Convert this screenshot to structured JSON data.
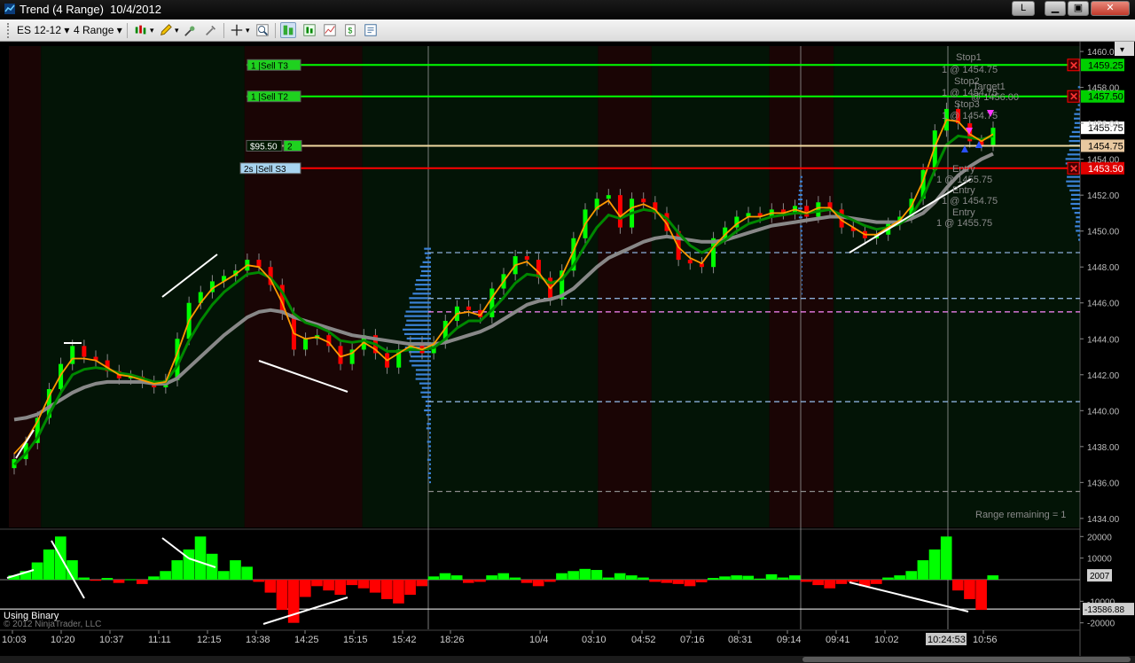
{
  "window": {
    "title": "Trend (4 Range)  10/4/2012",
    "buttons": {
      "link": "L",
      "minimize": "▁",
      "maximize": "▣",
      "close": "✕"
    }
  },
  "toolbar": {
    "instrument": "ES 12-12",
    "period": "4 Range",
    "icons": [
      "bar-style-icon",
      "pencil-icon",
      "cross-star-icon",
      "dropper-icon",
      "crosshair-icon",
      "zoom-icon",
      "chart-trader-icon",
      "data-box-icon",
      "chart-icon",
      "refresh-icon",
      "properties-icon"
    ]
  },
  "colors": {
    "bull": "#00ff00",
    "bear": "#ff0000",
    "ema_fast": "#ff9900",
    "ema_mid": "#008800",
    "ema_slow": "#888888",
    "target_line": "#00ff00",
    "stop_line": "#ff0000",
    "entry_line": "#f0d8a0",
    "pivot_dash": "#8aaed8",
    "pink_dash": "#ff88ff",
    "volume_profile": "#3b82d6"
  },
  "orders": {
    "target3": {
      "qty": "1",
      "label": "Sell T3",
      "price_tag": "1459.25",
      "price": 1459.25
    },
    "target2": {
      "qty": "1",
      "label": "Sell T2",
      "price_tag": "1457.50",
      "price": 1457.5
    },
    "position": {
      "pnl": "$95.50",
      "qty": "2",
      "price_tag": "1454.75",
      "price": 1454.75
    },
    "stop": {
      "qty": "2s",
      "label": "Sell S3",
      "price_tag": "1453.50",
      "price": 1453.5
    },
    "last_price": "1455.75",
    "last": 1455.75
  },
  "annotations": [
    "Stop1",
    "1 @ 1454.75",
    "Stop2",
    "1 @ 1454.75",
    "Target1",
    "@ 1456.00",
    "Stop3",
    "1 @ 1454.75",
    "Entry",
    "1 @ 1455.75",
    "Entry",
    "1 @ 1454.75",
    "Entry",
    "1 @ 1455.75"
  ],
  "range_remaining": "Range remaining = 1",
  "price_axis": {
    "labels": [
      "1460.0",
      "1458.00",
      "1456.00",
      "1454.00",
      "1452.00",
      "1450.00",
      "1448.00",
      "1446.00",
      "1444.00",
      "1442.00",
      "1440.00",
      "1438.00",
      "1436.00",
      "1434.00"
    ],
    "values": [
      1460,
      1458,
      1456,
      1454,
      1452,
      1450,
      1448,
      1446,
      1444,
      1442,
      1440,
      1438,
      1436,
      1434
    ]
  },
  "indicator": {
    "axis_labels": [
      "20000",
      "10000",
      "-10000",
      "-20000"
    ],
    "axis_values": [
      20000,
      10000,
      -10000,
      -20000
    ],
    "current_tag": "2007",
    "current_value": 2007,
    "low_tag": "-13586.88",
    "low_value": -13586.88,
    "title": "Using Binary",
    "copyright": "© 2012 NinjaTrader, LLC"
  },
  "time_axis": {
    "labels": [
      "10:03",
      "10:20",
      "10:37",
      "11:11",
      "12:15",
      "13:38",
      "14:25",
      "15:15",
      "15:42",
      "18:26",
      "10/4",
      "03:10",
      "04:52",
      "07:16",
      "08:31",
      "09:14",
      "09:41",
      "10:02",
      "10:56"
    ],
    "crosshair_time": "10:24:53"
  },
  "sessions": [
    {
      "from": 0,
      "to": 0.03,
      "type": "bear"
    },
    {
      "from": 0.03,
      "to": 0.22,
      "type": "bull"
    },
    {
      "from": 0.22,
      "to": 0.33,
      "type": "bear"
    },
    {
      "from": 0.33,
      "to": 0.55,
      "type": "bull"
    },
    {
      "from": 0.55,
      "to": 0.6,
      "type": "bear"
    },
    {
      "from": 0.6,
      "to": 0.71,
      "type": "bull"
    },
    {
      "from": 0.71,
      "to": 0.77,
      "type": "bear"
    },
    {
      "from": 0.77,
      "to": 1.0,
      "type": "bull"
    }
  ],
  "chart_data": {
    "type": "line",
    "ylim": [
      1433.5,
      1460.3
    ],
    "close": [
      1437.3,
      1438.2,
      1439.6,
      1441.2,
      1442.6,
      1443.6,
      1443.0,
      1442.8,
      1442.2,
      1441.8,
      1441.9,
      1441.6,
      1441.3,
      1441.7,
      1444.0,
      1446.0,
      1446.6,
      1447.2,
      1447.5,
      1447.8,
      1448.4,
      1448.0,
      1447.0,
      1445.4,
      1443.4,
      1444.0,
      1444.2,
      1443.6,
      1442.6,
      1443.4,
      1444.2,
      1443.2,
      1442.4,
      1443.4,
      1443.8,
      1443.2,
      1443.8,
      1445.0,
      1445.8,
      1445.6,
      1445.2,
      1446.8,
      1447.6,
      1448.6,
      1448.4,
      1447.4,
      1446.2,
      1447.8,
      1449.6,
      1451.2,
      1451.8,
      1452.0,
      1450.2,
      1451.8,
      1451.6,
      1451.0,
      1450.0,
      1448.4,
      1448.2,
      1448.0,
      1449.6,
      1450.2,
      1450.8,
      1451.0,
      1450.8,
      1451.2,
      1451.0,
      1451.4,
      1450.8,
      1451.6,
      1451.2,
      1450.2,
      1450.0,
      1449.6,
      1449.8,
      1450.4,
      1450.8,
      1451.8,
      1453.4,
      1455.6,
      1456.8,
      1456.0,
      1455.0,
      1454.8,
      1455.75
    ],
    "ema_fast": [
      1437.6,
      1438.3,
      1439.4,
      1440.8,
      1442.0,
      1442.9,
      1442.9,
      1442.8,
      1442.4,
      1442.0,
      1441.9,
      1441.7,
      1441.5,
      1441.6,
      1443.2,
      1445.0,
      1446.0,
      1446.8,
      1447.2,
      1447.6,
      1448.1,
      1448.0,
      1447.3,
      1446.0,
      1444.3,
      1444.0,
      1444.1,
      1443.8,
      1443.0,
      1443.2,
      1443.8,
      1443.4,
      1442.8,
      1443.2,
      1443.6,
      1443.4,
      1443.7,
      1444.6,
      1445.4,
      1445.5,
      1445.3,
      1446.3,
      1447.2,
      1448.1,
      1448.3,
      1447.7,
      1446.8,
      1447.5,
      1448.9,
      1450.4,
      1451.3,
      1451.7,
      1450.8,
      1451.3,
      1451.5,
      1451.2,
      1450.4,
      1449.1,
      1448.5,
      1448.2,
      1449.1,
      1449.8,
      1450.4,
      1450.8,
      1450.8,
      1451.0,
      1451.0,
      1451.2,
      1451.0,
      1451.3,
      1451.3,
      1450.6,
      1450.2,
      1449.8,
      1449.8,
      1450.2,
      1450.6,
      1451.4,
      1452.8,
      1454.7,
      1456.2,
      1456.1,
      1455.4,
      1455.0,
      1455.4
    ],
    "ema_mid": [
      1437.0,
      1437.6,
      1438.5,
      1439.8,
      1441.0,
      1442.0,
      1442.3,
      1442.4,
      1442.3,
      1442.1,
      1442.0,
      1441.8,
      1441.6,
      1441.6,
      1442.5,
      1443.9,
      1445.0,
      1445.9,
      1446.6,
      1447.1,
      1447.6,
      1447.7,
      1447.4,
      1446.6,
      1445.4,
      1444.9,
      1444.7,
      1444.4,
      1443.9,
      1443.8,
      1443.9,
      1443.7,
      1443.3,
      1443.3,
      1443.4,
      1443.4,
      1443.5,
      1444.0,
      1444.6,
      1445.0,
      1445.0,
      1445.6,
      1446.3,
      1447.1,
      1447.6,
      1447.5,
      1447.1,
      1447.3,
      1448.1,
      1449.2,
      1450.2,
      1450.9,
      1450.7,
      1451.0,
      1451.2,
      1451.1,
      1450.7,
      1449.9,
      1449.2,
      1448.8,
      1449.1,
      1449.5,
      1450.0,
      1450.4,
      1450.6,
      1450.8,
      1450.9,
      1451.0,
      1451.0,
      1451.1,
      1451.2,
      1450.9,
      1450.6,
      1450.3,
      1450.1,
      1450.2,
      1450.4,
      1450.9,
      1451.9,
      1453.4,
      1454.8,
      1455.3,
      1455.2,
      1455.1,
      1455.3
    ],
    "ema_slow": [
      1439.5,
      1439.6,
      1439.8,
      1440.2,
      1440.6,
      1441.0,
      1441.3,
      1441.5,
      1441.6,
      1441.6,
      1441.6,
      1441.6,
      1441.5,
      1441.5,
      1441.8,
      1442.4,
      1443.0,
      1443.6,
      1444.2,
      1444.7,
      1445.2,
      1445.5,
      1445.6,
      1445.5,
      1445.2,
      1445.0,
      1444.8,
      1444.6,
      1444.4,
      1444.2,
      1444.1,
      1444.0,
      1443.9,
      1443.8,
      1443.7,
      1443.7,
      1443.7,
      1443.8,
      1444.0,
      1444.2,
      1444.4,
      1444.7,
      1445.1,
      1445.5,
      1445.9,
      1446.1,
      1446.2,
      1446.4,
      1446.8,
      1447.4,
      1448.0,
      1448.5,
      1448.8,
      1449.1,
      1449.4,
      1449.6,
      1449.7,
      1449.6,
      1449.5,
      1449.4,
      1449.4,
      1449.5,
      1449.7,
      1449.9,
      1450.1,
      1450.3,
      1450.4,
      1450.5,
      1450.6,
      1450.7,
      1450.8,
      1450.8,
      1450.7,
      1450.6,
      1450.5,
      1450.5,
      1450.5,
      1450.7,
      1451.0,
      1451.6,
      1452.4,
      1453.1,
      1453.6,
      1454.0,
      1454.3
    ],
    "indicator_values": [
      2000,
      4000,
      8000,
      14000,
      20000,
      9000,
      1000,
      -500,
      800,
      -1500,
      200,
      -2000,
      1500,
      4000,
      9000,
      14000,
      20000,
      12000,
      4000,
      9000,
      6000,
      -1000,
      -6000,
      -14000,
      -20000,
      -8000,
      -3000,
      -5000,
      -7000,
      -2500,
      -4000,
      -6000,
      -9000,
      -11000,
      -7000,
      -3000,
      1500,
      3000,
      2000,
      -1500,
      -1000,
      2000,
      3000,
      1000,
      -1500,
      -3000,
      -1000,
      3000,
      4000,
      5000,
      4500,
      1000,
      3000,
      2000,
      1000,
      -1000,
      -1500,
      -2000,
      -3000,
      -1200,
      800,
      1500,
      2000,
      1800,
      500,
      2500,
      1000,
      2000,
      -1000,
      -2500,
      -4000,
      -2000,
      -1000,
      -3000,
      -2000,
      1000,
      2000,
      4000,
      9000,
      14000,
      20000,
      -5000,
      -9000,
      -14000,
      2007
    ],
    "indicator_ylim": [
      -23000,
      23000
    ]
  }
}
